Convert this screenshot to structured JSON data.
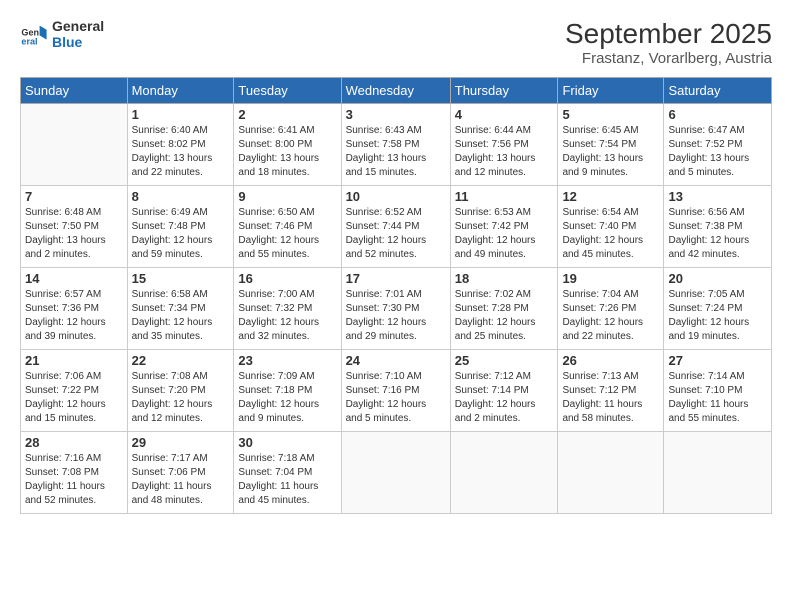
{
  "logo": {
    "text_general": "General",
    "text_blue": "Blue"
  },
  "title": "September 2025",
  "subtitle": "Frastanz, Vorarlberg, Austria",
  "weekdays": [
    "Sunday",
    "Monday",
    "Tuesday",
    "Wednesday",
    "Thursday",
    "Friday",
    "Saturday"
  ],
  "weeks": [
    [
      {
        "day": "",
        "info": ""
      },
      {
        "day": "1",
        "info": "Sunrise: 6:40 AM\nSunset: 8:02 PM\nDaylight: 13 hours\nand 22 minutes."
      },
      {
        "day": "2",
        "info": "Sunrise: 6:41 AM\nSunset: 8:00 PM\nDaylight: 13 hours\nand 18 minutes."
      },
      {
        "day": "3",
        "info": "Sunrise: 6:43 AM\nSunset: 7:58 PM\nDaylight: 13 hours\nand 15 minutes."
      },
      {
        "day": "4",
        "info": "Sunrise: 6:44 AM\nSunset: 7:56 PM\nDaylight: 13 hours\nand 12 minutes."
      },
      {
        "day": "5",
        "info": "Sunrise: 6:45 AM\nSunset: 7:54 PM\nDaylight: 13 hours\nand 9 minutes."
      },
      {
        "day": "6",
        "info": "Sunrise: 6:47 AM\nSunset: 7:52 PM\nDaylight: 13 hours\nand 5 minutes."
      }
    ],
    [
      {
        "day": "7",
        "info": "Sunrise: 6:48 AM\nSunset: 7:50 PM\nDaylight: 13 hours\nand 2 minutes."
      },
      {
        "day": "8",
        "info": "Sunrise: 6:49 AM\nSunset: 7:48 PM\nDaylight: 12 hours\nand 59 minutes."
      },
      {
        "day": "9",
        "info": "Sunrise: 6:50 AM\nSunset: 7:46 PM\nDaylight: 12 hours\nand 55 minutes."
      },
      {
        "day": "10",
        "info": "Sunrise: 6:52 AM\nSunset: 7:44 PM\nDaylight: 12 hours\nand 52 minutes."
      },
      {
        "day": "11",
        "info": "Sunrise: 6:53 AM\nSunset: 7:42 PM\nDaylight: 12 hours\nand 49 minutes."
      },
      {
        "day": "12",
        "info": "Sunrise: 6:54 AM\nSunset: 7:40 PM\nDaylight: 12 hours\nand 45 minutes."
      },
      {
        "day": "13",
        "info": "Sunrise: 6:56 AM\nSunset: 7:38 PM\nDaylight: 12 hours\nand 42 minutes."
      }
    ],
    [
      {
        "day": "14",
        "info": "Sunrise: 6:57 AM\nSunset: 7:36 PM\nDaylight: 12 hours\nand 39 minutes."
      },
      {
        "day": "15",
        "info": "Sunrise: 6:58 AM\nSunset: 7:34 PM\nDaylight: 12 hours\nand 35 minutes."
      },
      {
        "day": "16",
        "info": "Sunrise: 7:00 AM\nSunset: 7:32 PM\nDaylight: 12 hours\nand 32 minutes."
      },
      {
        "day": "17",
        "info": "Sunrise: 7:01 AM\nSunset: 7:30 PM\nDaylight: 12 hours\nand 29 minutes."
      },
      {
        "day": "18",
        "info": "Sunrise: 7:02 AM\nSunset: 7:28 PM\nDaylight: 12 hours\nand 25 minutes."
      },
      {
        "day": "19",
        "info": "Sunrise: 7:04 AM\nSunset: 7:26 PM\nDaylight: 12 hours\nand 22 minutes."
      },
      {
        "day": "20",
        "info": "Sunrise: 7:05 AM\nSunset: 7:24 PM\nDaylight: 12 hours\nand 19 minutes."
      }
    ],
    [
      {
        "day": "21",
        "info": "Sunrise: 7:06 AM\nSunset: 7:22 PM\nDaylight: 12 hours\nand 15 minutes."
      },
      {
        "day": "22",
        "info": "Sunrise: 7:08 AM\nSunset: 7:20 PM\nDaylight: 12 hours\nand 12 minutes."
      },
      {
        "day": "23",
        "info": "Sunrise: 7:09 AM\nSunset: 7:18 PM\nDaylight: 12 hours\nand 9 minutes."
      },
      {
        "day": "24",
        "info": "Sunrise: 7:10 AM\nSunset: 7:16 PM\nDaylight: 12 hours\nand 5 minutes."
      },
      {
        "day": "25",
        "info": "Sunrise: 7:12 AM\nSunset: 7:14 PM\nDaylight: 12 hours\nand 2 minutes."
      },
      {
        "day": "26",
        "info": "Sunrise: 7:13 AM\nSunset: 7:12 PM\nDaylight: 11 hours\nand 58 minutes."
      },
      {
        "day": "27",
        "info": "Sunrise: 7:14 AM\nSunset: 7:10 PM\nDaylight: 11 hours\nand 55 minutes."
      }
    ],
    [
      {
        "day": "28",
        "info": "Sunrise: 7:16 AM\nSunset: 7:08 PM\nDaylight: 11 hours\nand 52 minutes."
      },
      {
        "day": "29",
        "info": "Sunrise: 7:17 AM\nSunset: 7:06 PM\nDaylight: 11 hours\nand 48 minutes."
      },
      {
        "day": "30",
        "info": "Sunrise: 7:18 AM\nSunset: 7:04 PM\nDaylight: 11 hours\nand 45 minutes."
      },
      {
        "day": "",
        "info": ""
      },
      {
        "day": "",
        "info": ""
      },
      {
        "day": "",
        "info": ""
      },
      {
        "day": "",
        "info": ""
      }
    ]
  ]
}
